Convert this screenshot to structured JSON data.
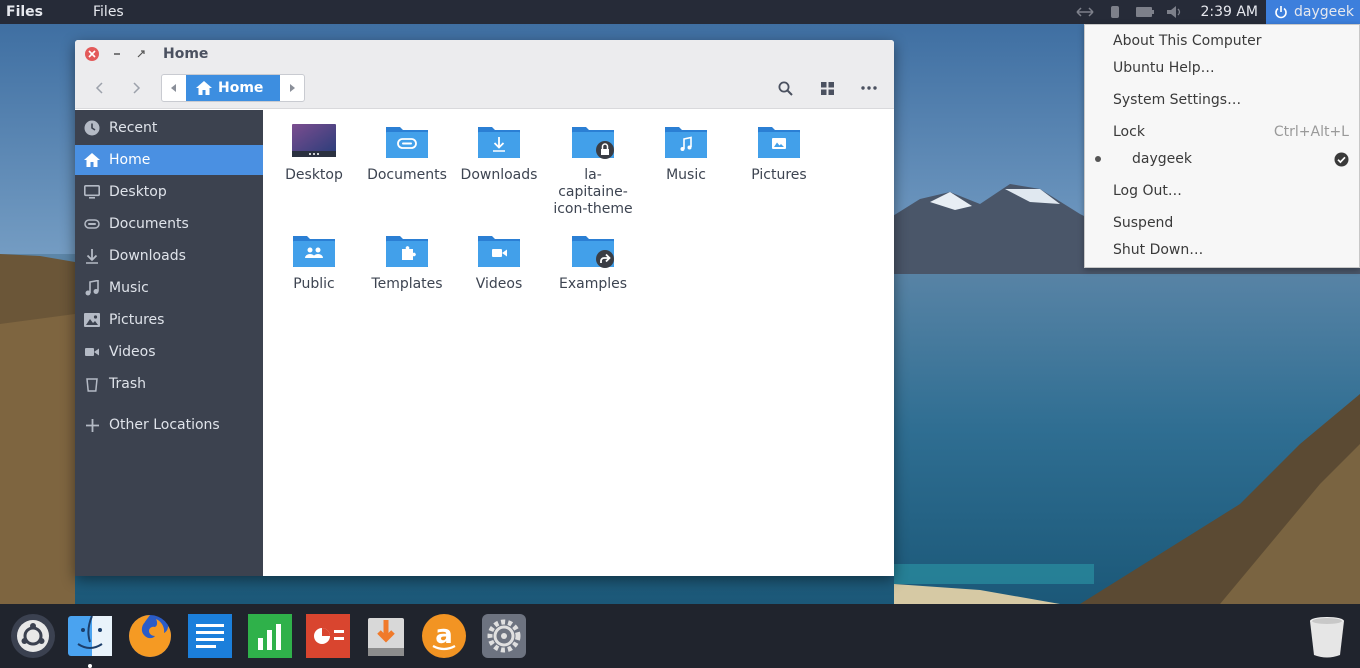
{
  "panel": {
    "app_name": "Files",
    "app_menu": "Files",
    "clock": "2:39 AM",
    "username": "daygeek"
  },
  "user_menu": {
    "about": "About This Computer",
    "help": "Ubuntu Help…",
    "settings": "System Settings…",
    "lock": "Lock",
    "lock_shortcut": "Ctrl+Alt+L",
    "user": "daygeek",
    "logout": "Log Out…",
    "suspend": "Suspend",
    "shutdown": "Shut Down…"
  },
  "window": {
    "title": "Home",
    "path": "Home"
  },
  "sidebar": {
    "items": [
      "Recent",
      "Home",
      "Desktop",
      "Documents",
      "Downloads",
      "Music",
      "Pictures",
      "Videos",
      "Trash"
    ],
    "other": "Other Locations",
    "active": "Home"
  },
  "files": {
    "desktop": "Desktop",
    "documents": "Documents",
    "downloads": "Downloads",
    "theme": "la-capitaine-icon-theme",
    "music": "Music",
    "pictures": "Pictures",
    "public": "Public",
    "templates": "Templates",
    "videos": "Videos",
    "examples": "Examples"
  },
  "colors": {
    "accent": "#4a90e2",
    "folder": "#3d9ae3",
    "sidebar": "#3c424f",
    "panel": "#262b38"
  },
  "dock": {
    "items": [
      "ubuntu-logo-icon",
      "finder-icon",
      "firefox-icon",
      "writer-icon",
      "calc-icon",
      "impress-icon",
      "software-center-icon",
      "amazon-icon",
      "settings-icon",
      "trash-icon"
    ]
  }
}
